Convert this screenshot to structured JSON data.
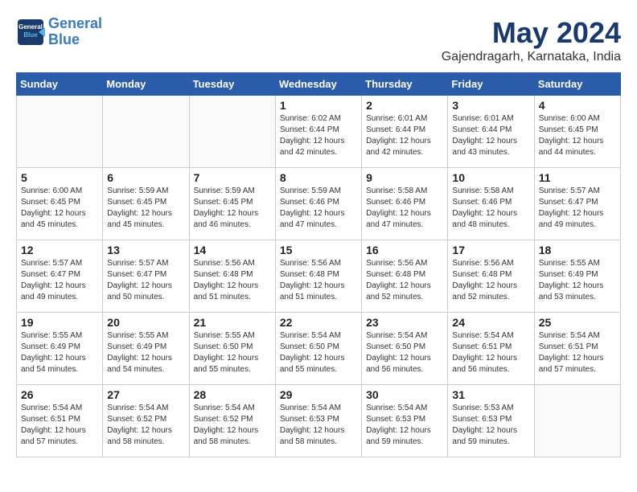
{
  "logo": {
    "line1": "General",
    "line2": "Blue"
  },
  "title": "May 2024",
  "location": "Gajendragarh, Karnataka, India",
  "days_header": [
    "Sunday",
    "Monday",
    "Tuesday",
    "Wednesday",
    "Thursday",
    "Friday",
    "Saturday"
  ],
  "weeks": [
    [
      {
        "day": "",
        "info": "",
        "empty": true
      },
      {
        "day": "",
        "info": "",
        "empty": true
      },
      {
        "day": "",
        "info": "",
        "empty": true
      },
      {
        "day": "1",
        "info": "Sunrise: 6:02 AM\nSunset: 6:44 PM\nDaylight: 12 hours\nand 42 minutes."
      },
      {
        "day": "2",
        "info": "Sunrise: 6:01 AM\nSunset: 6:44 PM\nDaylight: 12 hours\nand 42 minutes."
      },
      {
        "day": "3",
        "info": "Sunrise: 6:01 AM\nSunset: 6:44 PM\nDaylight: 12 hours\nand 43 minutes."
      },
      {
        "day": "4",
        "info": "Sunrise: 6:00 AM\nSunset: 6:45 PM\nDaylight: 12 hours\nand 44 minutes."
      }
    ],
    [
      {
        "day": "5",
        "info": "Sunrise: 6:00 AM\nSunset: 6:45 PM\nDaylight: 12 hours\nand 45 minutes."
      },
      {
        "day": "6",
        "info": "Sunrise: 5:59 AM\nSunset: 6:45 PM\nDaylight: 12 hours\nand 45 minutes."
      },
      {
        "day": "7",
        "info": "Sunrise: 5:59 AM\nSunset: 6:45 PM\nDaylight: 12 hours\nand 46 minutes."
      },
      {
        "day": "8",
        "info": "Sunrise: 5:59 AM\nSunset: 6:46 PM\nDaylight: 12 hours\nand 47 minutes."
      },
      {
        "day": "9",
        "info": "Sunrise: 5:58 AM\nSunset: 6:46 PM\nDaylight: 12 hours\nand 47 minutes."
      },
      {
        "day": "10",
        "info": "Sunrise: 5:58 AM\nSunset: 6:46 PM\nDaylight: 12 hours\nand 48 minutes."
      },
      {
        "day": "11",
        "info": "Sunrise: 5:57 AM\nSunset: 6:47 PM\nDaylight: 12 hours\nand 49 minutes."
      }
    ],
    [
      {
        "day": "12",
        "info": "Sunrise: 5:57 AM\nSunset: 6:47 PM\nDaylight: 12 hours\nand 49 minutes."
      },
      {
        "day": "13",
        "info": "Sunrise: 5:57 AM\nSunset: 6:47 PM\nDaylight: 12 hours\nand 50 minutes."
      },
      {
        "day": "14",
        "info": "Sunrise: 5:56 AM\nSunset: 6:48 PM\nDaylight: 12 hours\nand 51 minutes."
      },
      {
        "day": "15",
        "info": "Sunrise: 5:56 AM\nSunset: 6:48 PM\nDaylight: 12 hours\nand 51 minutes."
      },
      {
        "day": "16",
        "info": "Sunrise: 5:56 AM\nSunset: 6:48 PM\nDaylight: 12 hours\nand 52 minutes."
      },
      {
        "day": "17",
        "info": "Sunrise: 5:56 AM\nSunset: 6:48 PM\nDaylight: 12 hours\nand 52 minutes."
      },
      {
        "day": "18",
        "info": "Sunrise: 5:55 AM\nSunset: 6:49 PM\nDaylight: 12 hours\nand 53 minutes."
      }
    ],
    [
      {
        "day": "19",
        "info": "Sunrise: 5:55 AM\nSunset: 6:49 PM\nDaylight: 12 hours\nand 54 minutes."
      },
      {
        "day": "20",
        "info": "Sunrise: 5:55 AM\nSunset: 6:49 PM\nDaylight: 12 hours\nand 54 minutes."
      },
      {
        "day": "21",
        "info": "Sunrise: 5:55 AM\nSunset: 6:50 PM\nDaylight: 12 hours\nand 55 minutes."
      },
      {
        "day": "22",
        "info": "Sunrise: 5:54 AM\nSunset: 6:50 PM\nDaylight: 12 hours\nand 55 minutes."
      },
      {
        "day": "23",
        "info": "Sunrise: 5:54 AM\nSunset: 6:50 PM\nDaylight: 12 hours\nand 56 minutes."
      },
      {
        "day": "24",
        "info": "Sunrise: 5:54 AM\nSunset: 6:51 PM\nDaylight: 12 hours\nand 56 minutes."
      },
      {
        "day": "25",
        "info": "Sunrise: 5:54 AM\nSunset: 6:51 PM\nDaylight: 12 hours\nand 57 minutes."
      }
    ],
    [
      {
        "day": "26",
        "info": "Sunrise: 5:54 AM\nSunset: 6:51 PM\nDaylight: 12 hours\nand 57 minutes."
      },
      {
        "day": "27",
        "info": "Sunrise: 5:54 AM\nSunset: 6:52 PM\nDaylight: 12 hours\nand 58 minutes."
      },
      {
        "day": "28",
        "info": "Sunrise: 5:54 AM\nSunset: 6:52 PM\nDaylight: 12 hours\nand 58 minutes."
      },
      {
        "day": "29",
        "info": "Sunrise: 5:54 AM\nSunset: 6:53 PM\nDaylight: 12 hours\nand 58 minutes."
      },
      {
        "day": "30",
        "info": "Sunrise: 5:54 AM\nSunset: 6:53 PM\nDaylight: 12 hours\nand 59 minutes."
      },
      {
        "day": "31",
        "info": "Sunrise: 5:53 AM\nSunset: 6:53 PM\nDaylight: 12 hours\nand 59 minutes."
      },
      {
        "day": "",
        "info": "",
        "empty": true
      }
    ]
  ]
}
